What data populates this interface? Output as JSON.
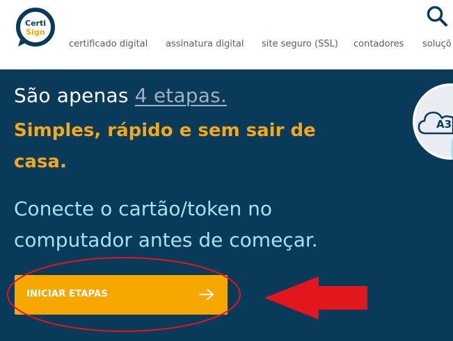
{
  "brand": {
    "logo_line1": "Certi",
    "logo_line2": "Sign",
    "colors": {
      "navy": "#0a3a5a",
      "yellow": "#f6a800",
      "light_blue": "#a9e1f1"
    }
  },
  "nav": {
    "items": [
      {
        "label": "certificado digital"
      },
      {
        "label": "assinatura digital"
      },
      {
        "label": "site seguro (SSL)"
      },
      {
        "label": "contadores"
      },
      {
        "label": "soluçõ"
      }
    ],
    "search_icon": "search-icon"
  },
  "hero": {
    "line1_prefix": "São apenas ",
    "line1_link": "4 etapas.",
    "headline_bold": "Simples, rápido e sem sair de casa.",
    "subtitle": "Conecte o cartão/token no computador antes de começar.",
    "cta_label": "INICIAR ETAPAS",
    "cta_icon": "arrow-right-icon",
    "deco_label": "A3"
  },
  "annotations": {
    "color": "#e3161e",
    "ellipse": "circle-highlight",
    "arrow": "arrow-left-pointer"
  }
}
